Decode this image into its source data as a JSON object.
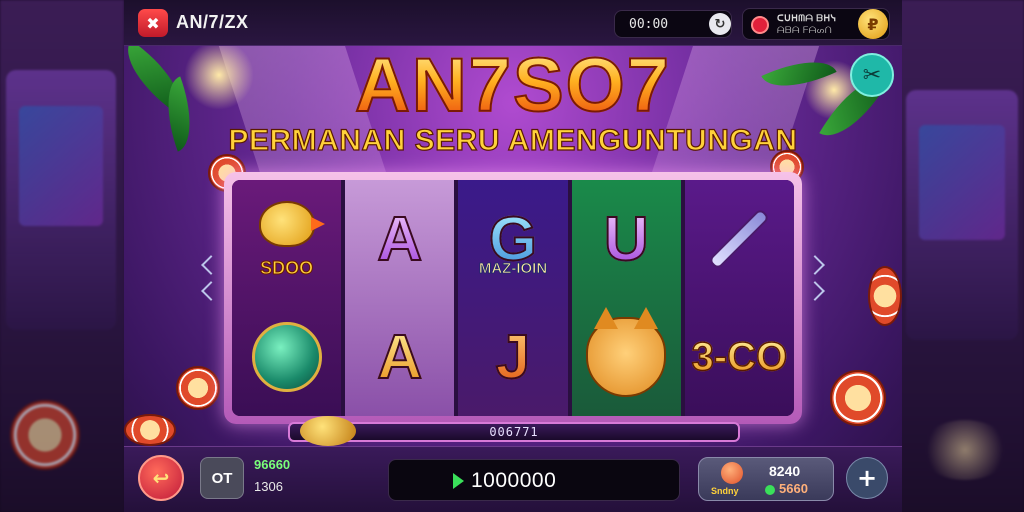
{
  "app": {
    "logo_glyph": "✖",
    "title": "AN/7/ZX"
  },
  "topbar": {
    "balance": "00:00",
    "refresh_glyph": "↻",
    "user_line1": "ᑕᑌᕼᗰᗩ ᗷᕼᓭ",
    "user_line2": "ᗩᗷᗩ ᖴᗩᔕᑎ",
    "coin_glyph": "₽"
  },
  "header": {
    "title": "AN7SO7",
    "subtitle": "PERMANAN SERU  AMENGUNTUNGAN",
    "close_glyph": "✂"
  },
  "reels": [
    {
      "symbols": [
        {
          "type": "bird",
          "label": "SDOO"
        },
        {
          "type": "orb",
          "label": ""
        }
      ]
    },
    {
      "symbols": [
        {
          "type": "letter",
          "text": "A",
          "style": "purple"
        },
        {
          "type": "letter",
          "text": "A",
          "style": "gold"
        }
      ]
    },
    {
      "symbols": [
        {
          "type": "letter",
          "text": "G",
          "style": "teal",
          "label": "MAZ-IOIN"
        },
        {
          "type": "letter",
          "text": "J",
          "style": "orange"
        }
      ]
    },
    {
      "symbols": [
        {
          "type": "letter",
          "text": "U",
          "style": "purple"
        },
        {
          "type": "cat",
          "label": ""
        }
      ]
    },
    {
      "symbols": [
        {
          "type": "sword",
          "label": ""
        },
        {
          "type": "number",
          "text": "3-CO"
        }
      ]
    }
  ],
  "win_bar": {
    "value": "006771"
  },
  "controls": {
    "back_glyph": "↩",
    "bet_box": "OT",
    "bet_value_1": "96660",
    "bet_value_2": "1306",
    "spin_value": "1000000",
    "stats_label": "Sndny",
    "stats_value_1": "8240",
    "stats_value_2": "5660",
    "add_glyph": "+"
  },
  "colors": {
    "accent": "#ffd23a",
    "frame": "#d87ad8",
    "spin_green": "#3adf5a"
  },
  "icons": [
    "logo-icon",
    "refresh-icon",
    "avatar",
    "coin-icon",
    "close-icon",
    "back-icon",
    "play-icon",
    "add-icon"
  ]
}
